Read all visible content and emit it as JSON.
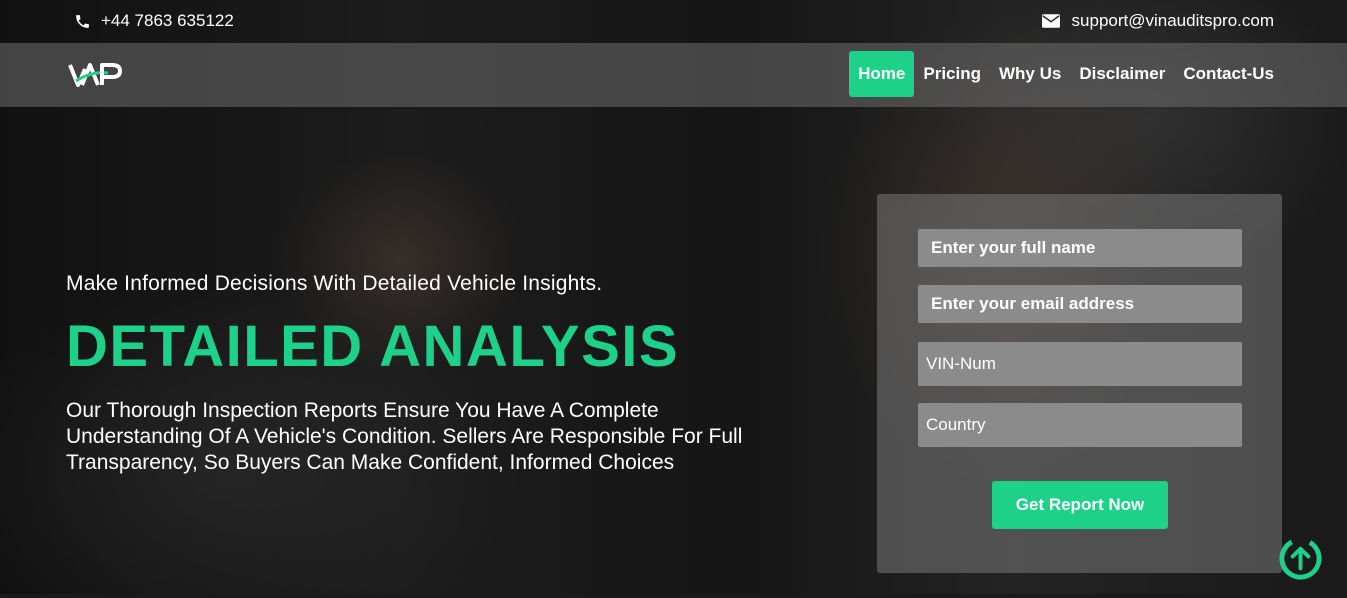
{
  "topbar": {
    "phone": "+44 7863 635122",
    "email": "support@vinauditspro.com"
  },
  "navbar": {
    "logo_text": "VAP",
    "items": [
      {
        "label": "Home",
        "active": true
      },
      {
        "label": "Pricing"
      },
      {
        "label": "Why Us"
      },
      {
        "label": "Disclaimer"
      },
      {
        "label": "Contact-Us"
      }
    ]
  },
  "hero": {
    "tagline": "Make Informed Decisions With Detailed Vehicle Insights.",
    "headline": "DETAILED ANALYSIS",
    "description": "Our Thorough Inspection Reports Ensure You Have A Complete Understanding Of A Vehicle's Condition. Sellers Are Responsible For Full Transparency, So Buyers Can Make Confident, Informed Choices"
  },
  "form": {
    "name_placeholder": "Enter your full name",
    "email_placeholder": "Enter your email address",
    "vin_placeholder": "VIN-Num",
    "country_placeholder": "Country",
    "submit_label": "Get Report Now"
  },
  "colors": {
    "accent": "#1ed189"
  },
  "icons": {
    "phone": "phone-icon",
    "email": "mail-icon",
    "scroll_top": "arrow-up-circle-icon"
  }
}
